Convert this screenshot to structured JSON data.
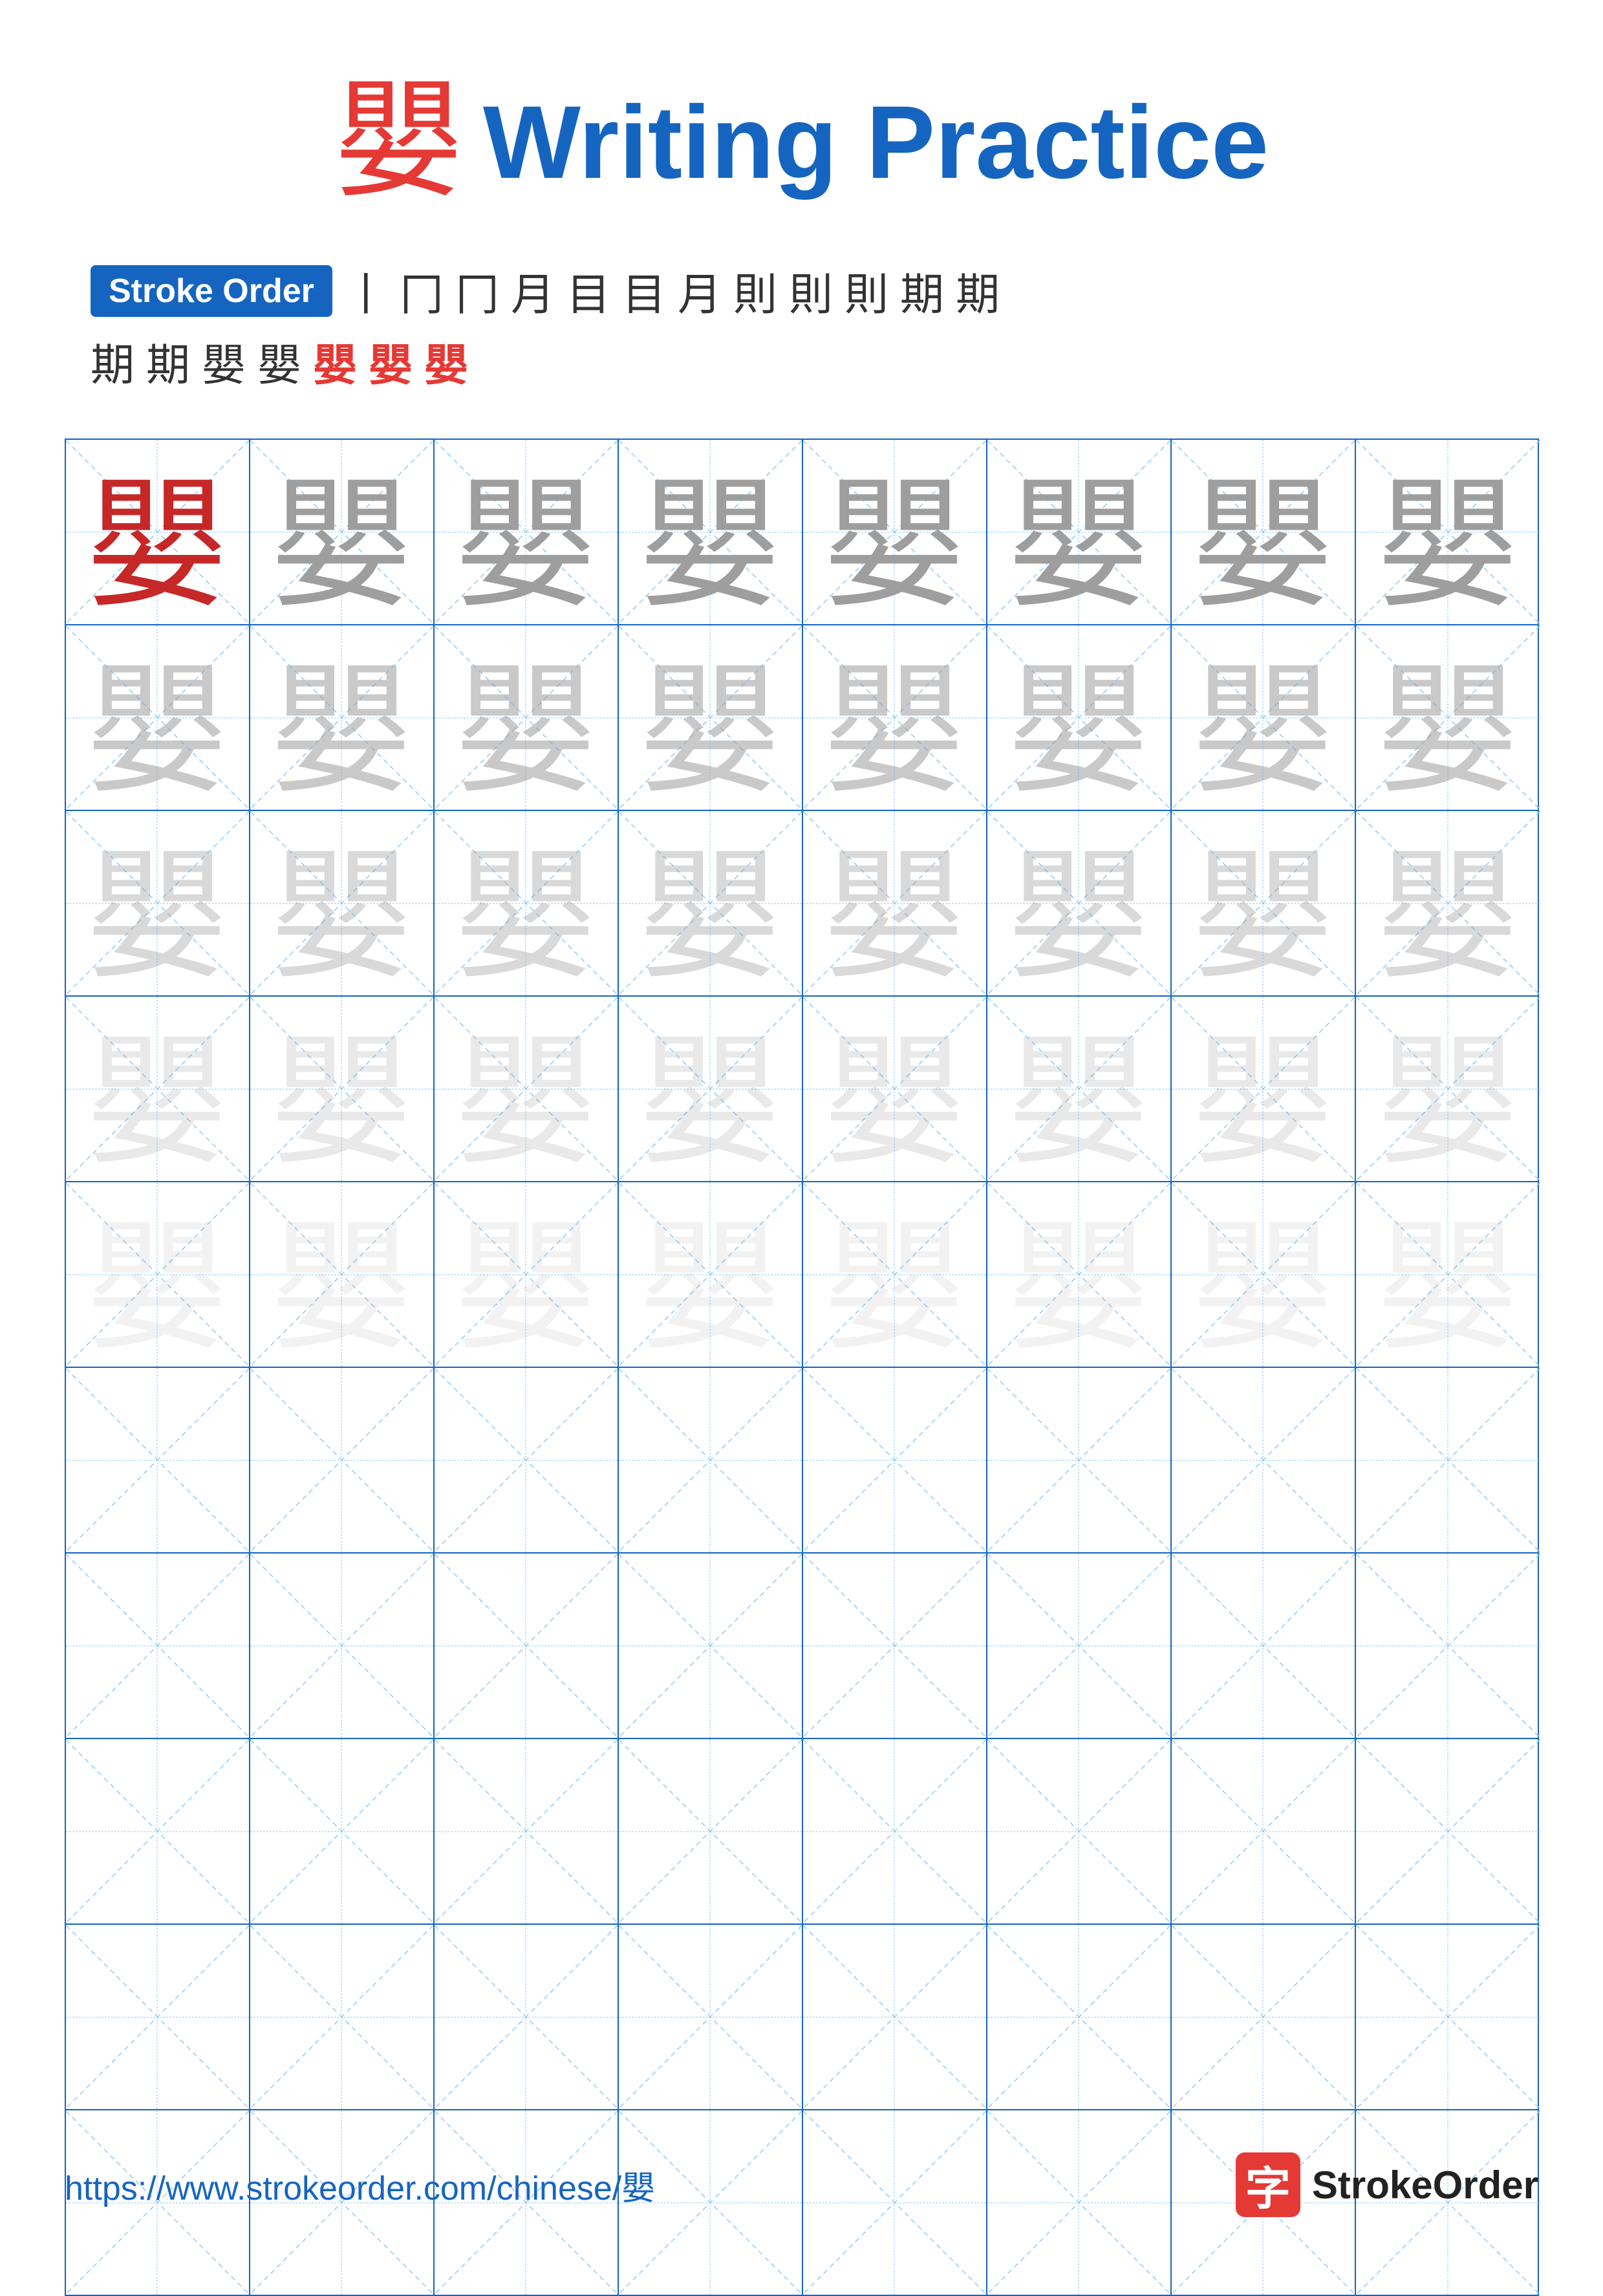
{
  "title": {
    "char": "嬰",
    "writing_practice": "Writing Practice"
  },
  "stroke_order": {
    "label": "Stroke Order",
    "strokes": [
      "丨",
      "冂",
      "冂",
      "月",
      "目",
      "目",
      "月",
      "則",
      "則",
      "則",
      "期",
      "期",
      "期",
      "期",
      "嬰",
      "嬰",
      "嬰",
      "嬰",
      "嬰"
    ]
  },
  "grid": {
    "cols": 8,
    "rows": 10,
    "char": "嬰",
    "guide_rows": 5
  },
  "footer": {
    "url": "https://www.strokeorder.com/chinese/嬰",
    "brand_char": "字",
    "brand_name": "StrokeOrder"
  }
}
